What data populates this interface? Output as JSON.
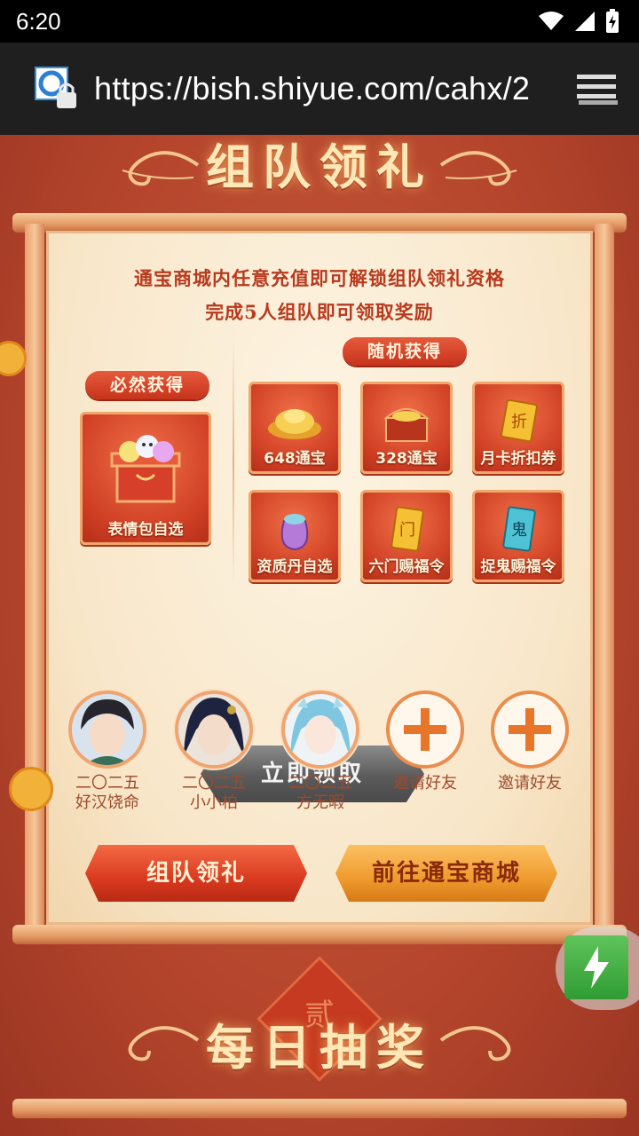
{
  "status_bar": {
    "time": "6:20"
  },
  "browser": {
    "url": "https://bish.shiyue.com/cahx/2"
  },
  "section1": {
    "title": "组队领礼",
    "desc_line1": "通宝商城内任意充值即可解锁组队领礼资格",
    "desc_line2": "完成5人组队即可领取奖励",
    "guaranteed_label": "必然获得",
    "random_label": "随机获得",
    "guaranteed_item": {
      "label": "表情包自选"
    },
    "random_items": [
      {
        "label": "648通宝"
      },
      {
        "label": "328通宝"
      },
      {
        "label": "月卡折扣券"
      },
      {
        "label": "资质丹自选"
      },
      {
        "label": "六门赐福令"
      },
      {
        "label": "捉鬼赐福令"
      }
    ],
    "claim_button": "立即领取",
    "members": [
      {
        "line1": "二〇二五",
        "line2": "好汉饶命"
      },
      {
        "line1": "二〇二五",
        "line2": "小小柏"
      },
      {
        "line1": "二〇二五",
        "line2": "方无暇"
      }
    ],
    "invite_label": "邀请好友",
    "team_button": "组队领礼",
    "store_button": "前往通宝商城"
  },
  "section2": {
    "title": "每日抽奖",
    "badge": "贰"
  },
  "colors": {
    "accent": "#c7331c",
    "paper": "#fbeed8",
    "gold": "#ef9a2e"
  }
}
